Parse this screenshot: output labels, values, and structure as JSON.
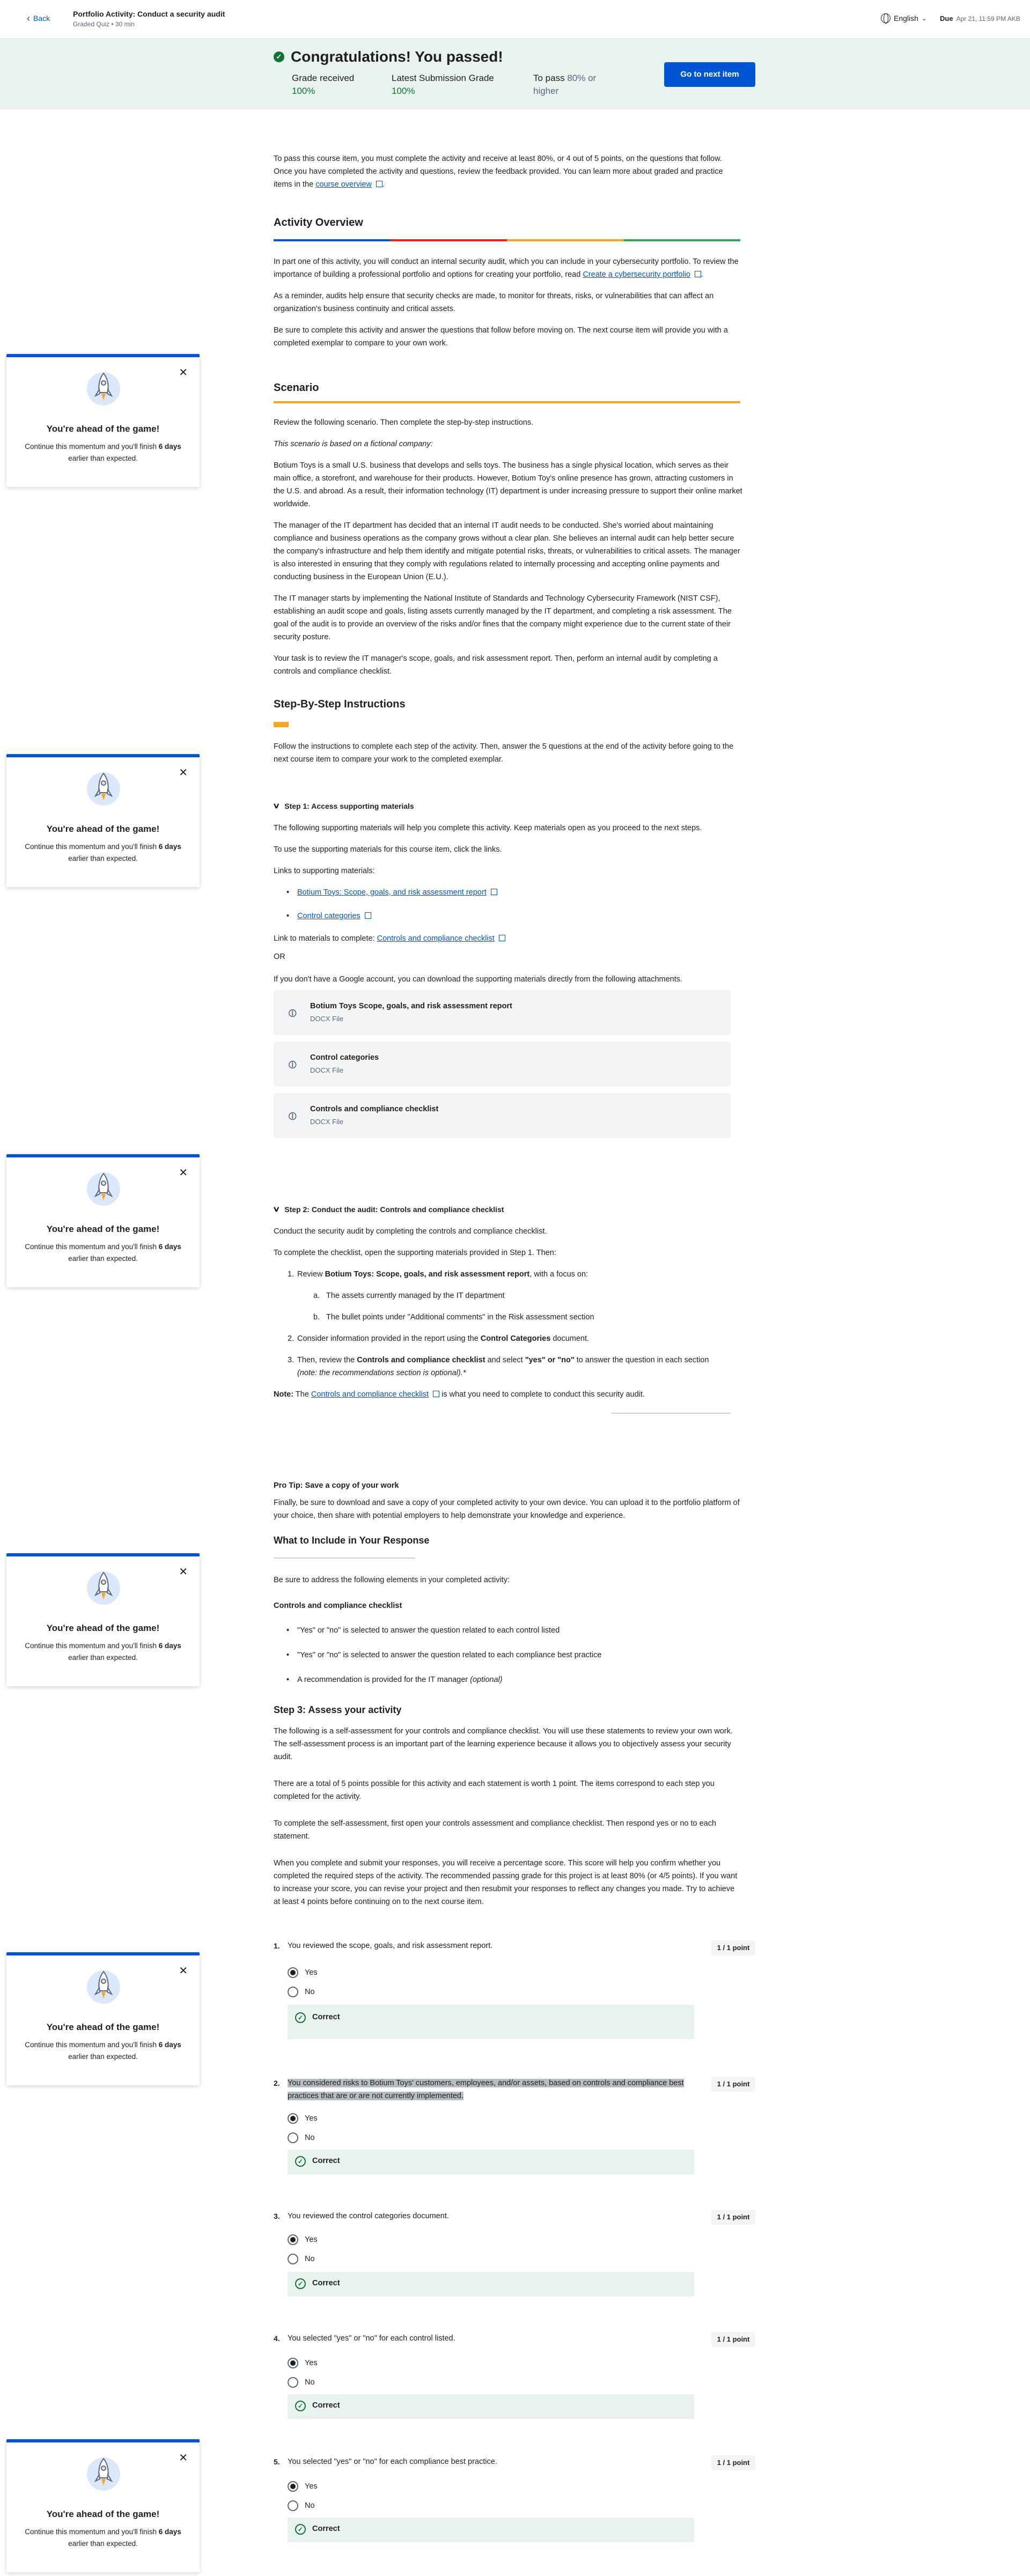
{
  "header": {
    "back_label": "Back",
    "title": "Portfolio Activity: Conduct a security audit",
    "subtitle": "Graded Quiz • 30 min",
    "language": "English",
    "due_label": "Due",
    "due_date": "Apr 21, 11:59 PM AKB"
  },
  "banner": {
    "heading": "Congratulations! You passed!",
    "grade_label": "Grade received",
    "grade_value": "100%",
    "latest_label": "Latest Submission Grade",
    "latest_value": "100%",
    "pass_label": "To pass",
    "pass_value": "80% or higher",
    "next_button": "Go to next item"
  },
  "intro": {
    "text": "To pass this course item, you must complete the activity and receive at least 80%, or 4 out of 5 points, on the questions that follow. Once you have completed the activity and questions, review the feedback provided. You can learn more about graded and practice items in the",
    "link": "course overview",
    "end": "."
  },
  "overview": {
    "heading": "Activity Overview",
    "p1": "In part one of this activity, you will conduct an internal security audit, which you can include in your cybersecurity portfolio. To review the importance of building a professional portfolio and options for creating your portfolio, read",
    "p1_link": "Create a cybersecurity portfolio",
    "p1_end": ".",
    "p2": "As a reminder, audits help ensure that security checks are made, to monitor for threats, risks, or vulnerabilities that can affect an organization's business continuity and critical assets.",
    "p3": "Be sure to complete this activity and answer the questions that follow before moving on. The next course item will provide you with a completed exemplar to compare to your own work."
  },
  "scenario": {
    "heading": "Scenario",
    "p1": "Review the following scenario. Then complete the step-by-step instructions.",
    "p2": "This scenario is based on a fictional company:",
    "p3": "Botium Toys is a small U.S. business that develops and sells toys. The business has a single physical location, which serves as their main office, a storefront, and warehouse for their products. However, Botium Toy's online presence has grown, attracting customers in the U.S. and abroad. As a result, their information technology (IT) department is under increasing pressure to support their online market worldwide.",
    "p4": "The manager of the IT department has decided that an internal IT audit needs to be conducted. She's worried about maintaining compliance and business operations as the company grows without a clear plan. She believes an internal audit can help better secure the company's infrastructure and help them identify and mitigate potential risks, threats, or vulnerabilities to critical assets. The manager is also interested in ensuring that they comply with regulations related to internally processing and accepting online payments and conducting business in the European Union (E.U.).",
    "p5": "The IT manager starts by implementing the National Institute of Standards and Technology Cybersecurity Framework (NIST CSF), establishing an audit scope and goals, listing assets currently managed by the IT department, and completing a risk assessment. The goal of the audit is to provide an overview of the risks and/or fines that the company might experience due to the current state of their security posture.",
    "p6": "Your task is to review the IT manager's scope, goals, and risk assessment report. Then, perform an internal audit by completing a controls and compliance checklist."
  },
  "instructions": {
    "heading": "Step-By-Step Instructions",
    "p1": "Follow the instructions to complete each step of the activity. Then, answer the 5 questions at the end of the activity before going to the next course item to compare your work to the completed exemplar."
  },
  "step1": {
    "title": "Step 1: Access supporting materials",
    "p1": "The following supporting materials will help you complete this activity. Keep materials open as you proceed to the next steps.",
    "p2": "To use the supporting materials for this course item, click the links.",
    "p3": "Links to supporting materials:",
    "link1": "Botium Toys: Scope, goals, and risk assessment report",
    "link2": "Control categories",
    "complete_label": "Link to materials to complete:",
    "complete_link": "Controls and compliance checklist",
    "or": "OR",
    "p4": "If you don't have a Google account, you can download the supporting materials directly from the following attachments.",
    "attachments": [
      {
        "name": "Botium Toys Scope, goals, and risk assessment report",
        "type": "DOCX File"
      },
      {
        "name": "Control categories",
        "type": "DOCX File"
      },
      {
        "name": "Controls and compliance checklist",
        "type": "DOCX File"
      }
    ]
  },
  "step2": {
    "title": "Step 2: Conduct the audit: Controls and compliance checklist",
    "p1": "Conduct the security audit by completing the controls and compliance checklist.",
    "p2": "To complete the checklist, open the supporting materials provided in Step 1. Then:",
    "item1_pre": "Review",
    "item1_bold": "Botium Toys: Scope, goals, and risk assessment report",
    "item1_post": ", with a focus on:",
    "sub_a": "The assets currently managed by the IT department",
    "sub_b": "The bullet points under \"Additional comments\" in the Risk assessment section",
    "item2_pre": "Consider information provided in the report using the",
    "item2_bold": "Control Categories",
    "item2_post": "document.",
    "item3_pre": "Then, review the",
    "item3_bold": "Controls and compliance checklist",
    "item3_mid": "and select",
    "item3_bold2": "\"yes\" or \"no\"",
    "item3_post": "to answer the question in each section",
    "item3_ital": "(note: the recommendations section is optional).*",
    "note_label": "Note:",
    "note_pre": "The",
    "note_link": "Controls and compliance checklist",
    "note_post": "is what you need to complete to conduct this security audit."
  },
  "protip": {
    "title": "Pro Tip: Save a copy of your work",
    "text": "Finally, be sure to download and save a copy of your completed activity to your own device. You can upload it to the portfolio platform of your choice, then share with potential employers to help demonstrate your knowledge and experience."
  },
  "include": {
    "heading": "What to Include in Your Response",
    "p1": "Be sure to address the following elements in your completed activity:",
    "sub": "Controls and compliance checklist",
    "items": [
      "\"Yes\" or \"no\" is selected to answer the question related to each control listed",
      "\"Yes\" or \"no\" is selected to answer the question related to each compliance best practice",
      "A recommendation is provided for the IT manager"
    ],
    "optional": "(optional)"
  },
  "step3": {
    "title": "Step 3: Assess your activity",
    "p1": "The following is a self-assessment for your controls and compliance checklist. You will use these statements to review your own work. The self-assessment process is an important part of the learning experience because it allows you to objectively assess your security audit.",
    "p2": "There are a total of 5 points possible for this activity and each statement is worth 1 point. The items correspond to each step you completed for the activity.",
    "p3": "To complete the self-assessment, first open your controls assessment and compliance checklist. Then respond yes or no to each statement.",
    "p4": "When you complete and submit your responses, you will receive a percentage score. This score will help you confirm whether you completed the required steps of the activity. The recommended passing grade for this project is at least 80% (or 4/5 points). If you want to increase your score, you can revise your project and then resubmit your responses to reflect any changes you made. Try to achieve at least 4 points before continuing on to the next course item."
  },
  "questions": [
    {
      "num": "1.",
      "text": "You reviewed the scope, goals, and risk assessment report.",
      "points": "1 / 1 point",
      "yes": "Yes",
      "no": "No",
      "feedback": "Correct"
    },
    {
      "num": "2.",
      "text": "You considered risks to Botium Toys' customers, employees, and/or assets, based on controls and compliance best practices that are or are not currently implemented.",
      "points": "1 / 1 point",
      "yes": "Yes",
      "no": "No",
      "feedback": "Correct"
    },
    {
      "num": "3.",
      "text": "You reviewed the control categories document.",
      "points": "1 / 1 point",
      "yes": "Yes",
      "no": "No",
      "feedback": "Correct"
    },
    {
      "num": "4.",
      "text": "You selected \"yes\" or \"no\" for each control listed.",
      "points": "1 / 1 point",
      "yes": "Yes",
      "no": "No",
      "feedback": "Correct"
    },
    {
      "num": "5.",
      "text": "You selected \"yes\" or \"no\" for each compliance best practice.",
      "points": "1 / 1 point",
      "yes": "Yes",
      "no": "No",
      "feedback": "Correct"
    }
  ],
  "side_card": {
    "title": "You're ahead of the game!",
    "msg_pre": "Continue this momentum and you'll finish",
    "msg_days": "6 days",
    "msg_post": "earlier than expected.",
    "icon": "rocket-icon"
  },
  "colors": {
    "accent": "#0056d2",
    "success": "#137333",
    "banner_bg": "#e8f2ef"
  }
}
